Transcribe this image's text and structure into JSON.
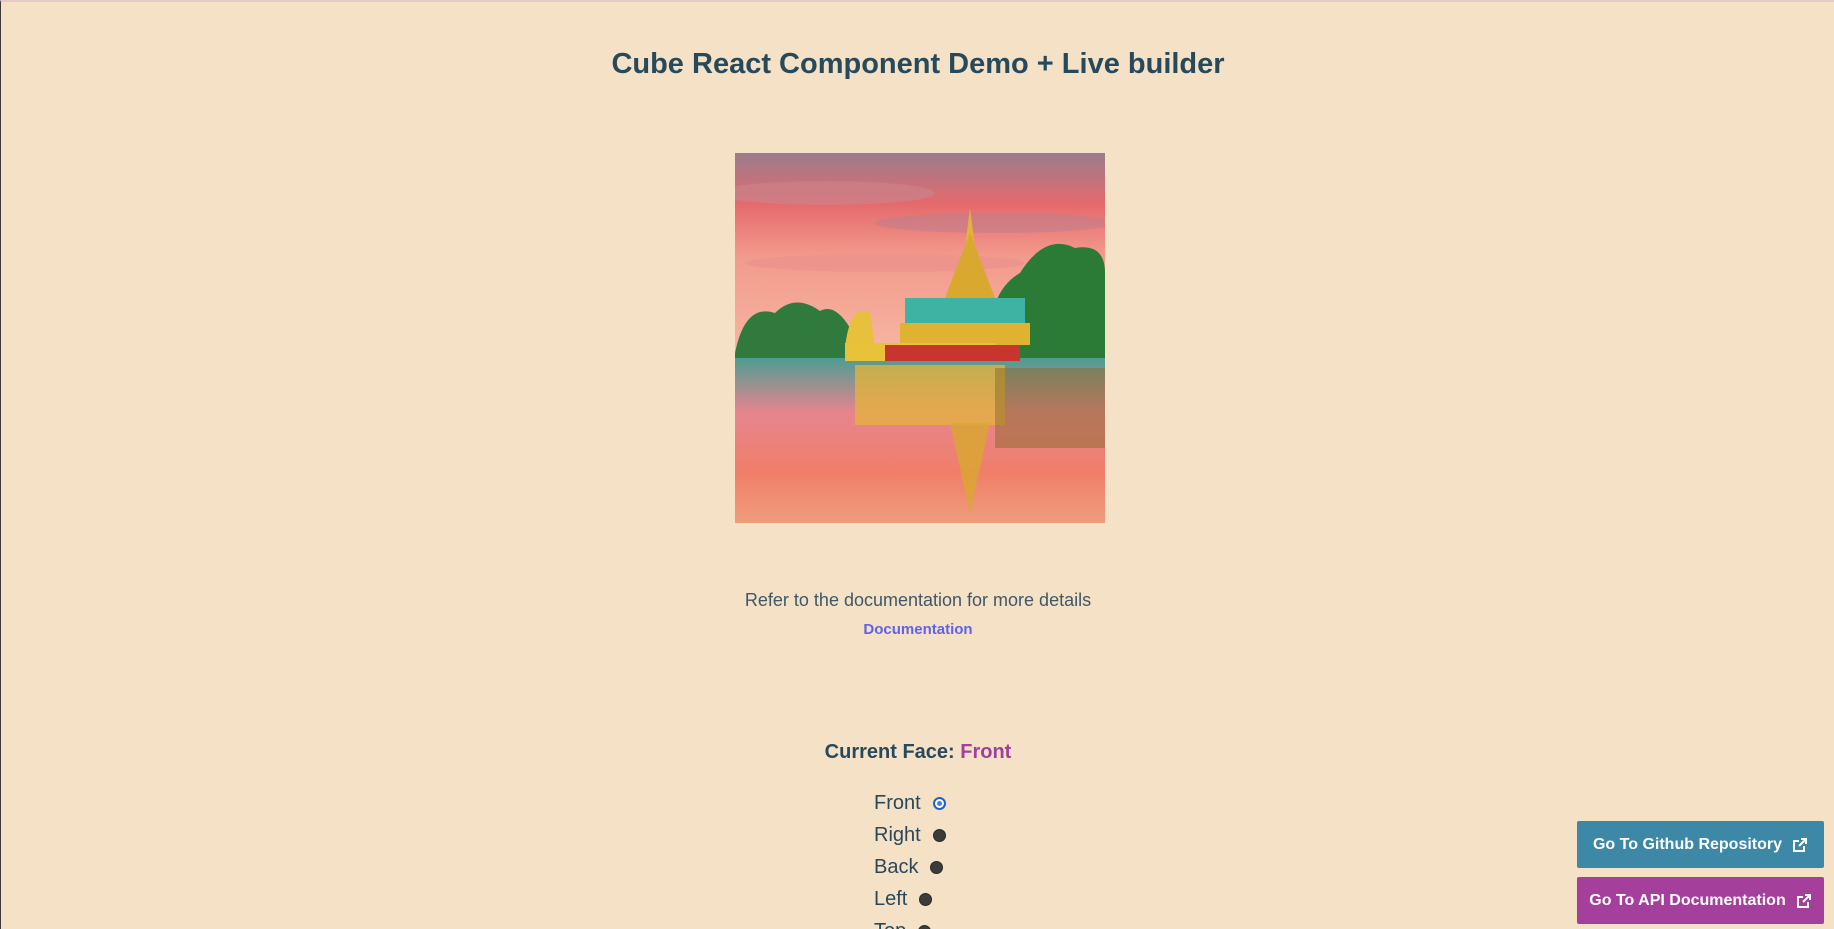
{
  "header": {
    "title": "Cube React Component Demo + Live builder"
  },
  "cube": {
    "image_description_icon": "temple-reflection-image"
  },
  "docs": {
    "text": "Refer to the documentation for more details",
    "link_label": "Documentation"
  },
  "current_face": {
    "label": "Current Face:",
    "value": "Front"
  },
  "faces": [
    {
      "label": "Front",
      "checked": true
    },
    {
      "label": "Right",
      "checked": false
    },
    {
      "label": "Back",
      "checked": false
    },
    {
      "label": "Left",
      "checked": false
    },
    {
      "label": "Top",
      "checked": false
    }
  ],
  "buttons": {
    "github": "Go To Github Repository",
    "api": "Go To API Documentation"
  },
  "colors": {
    "background": "#f5e1c5",
    "github_button": "#3c88a6",
    "api_button": "#a43f9c",
    "accent_value": "#a23e9d",
    "link": "#5f63ea"
  }
}
